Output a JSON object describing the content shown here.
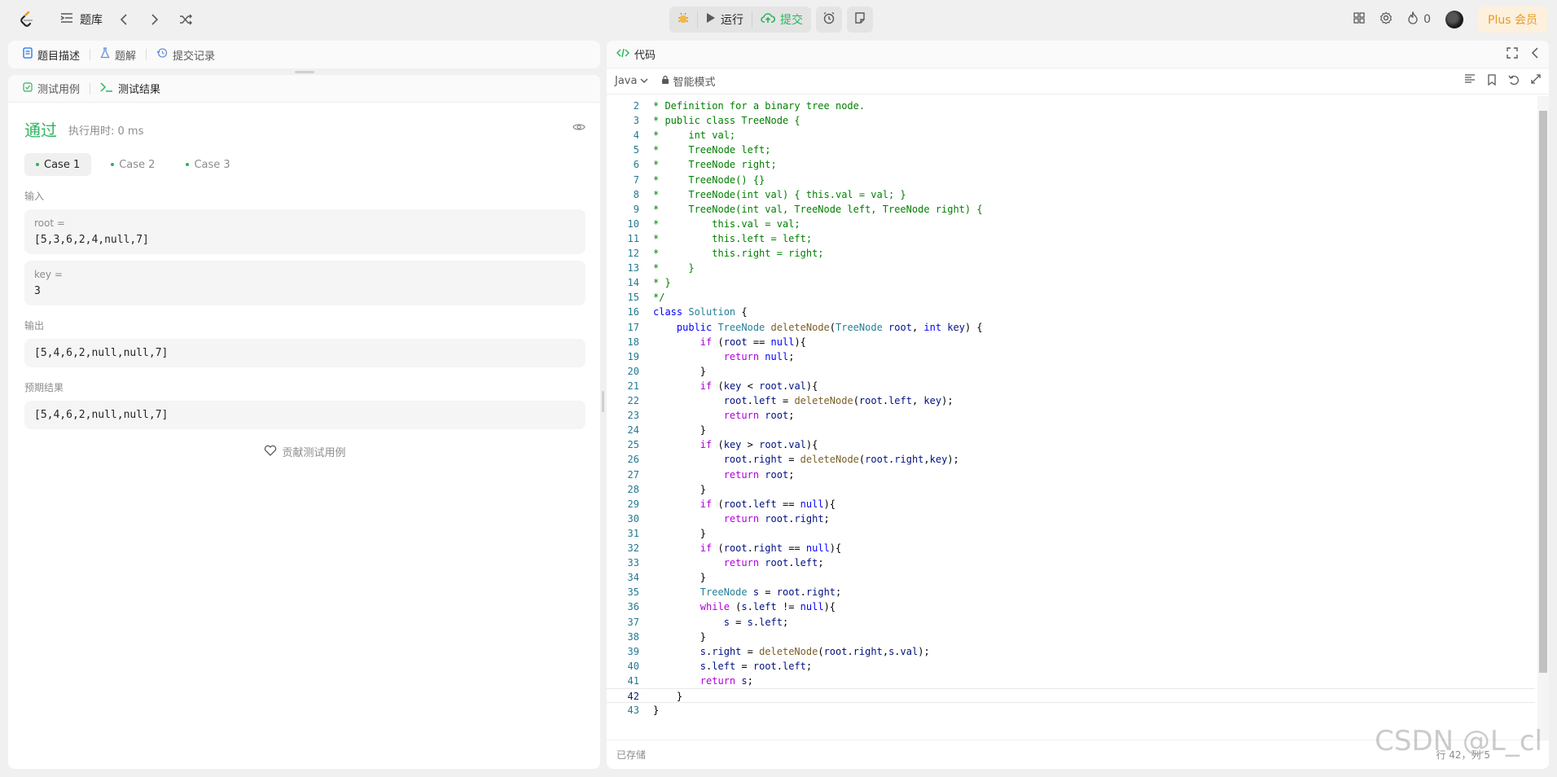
{
  "topnav": {
    "problem_list": "题库",
    "run": "运行",
    "submit": "提交",
    "fire_count": "0",
    "plus": "Plus 会员"
  },
  "desc_tabs": [
    {
      "label": "题目描述"
    },
    {
      "label": "题解"
    },
    {
      "label": "提交记录"
    }
  ],
  "result_tabs": [
    {
      "label": "测试用例"
    },
    {
      "label": "测试结果"
    }
  ],
  "result": {
    "status": "通过",
    "exec_time": "执行用时: 0 ms",
    "cases": [
      "Case 1",
      "Case 2",
      "Case 3"
    ],
    "input_label": "输入",
    "inputs": [
      {
        "name": "root =",
        "value": "[5,3,6,2,4,null,7]"
      },
      {
        "name": "key =",
        "value": "3"
      }
    ],
    "output_label": "输出",
    "output": "[5,4,6,2,null,null,7]",
    "expected_label": "预期结果",
    "expected": "[5,4,6,2,null,null,7]",
    "contribute": "贡献测试用例"
  },
  "code": {
    "title": "代码",
    "language": "Java",
    "mode": "智能模式",
    "saved": "已存储",
    "cursor": "行 42，列 5",
    "watermark": "CSDN @L_cl",
    "lines": [
      {
        "n": "2",
        "tokens": [
          [
            "c",
            "* Definition for a binary tree node."
          ]
        ]
      },
      {
        "n": "3",
        "tokens": [
          [
            "c",
            "* public class TreeNode {"
          ]
        ]
      },
      {
        "n": "4",
        "tokens": [
          [
            "c",
            "*     int val;"
          ]
        ]
      },
      {
        "n": "5",
        "tokens": [
          [
            "c",
            "*     TreeNode left;"
          ]
        ]
      },
      {
        "n": "6",
        "tokens": [
          [
            "c",
            "*     TreeNode right;"
          ]
        ]
      },
      {
        "n": "7",
        "tokens": [
          [
            "c",
            "*     TreeNode() {}"
          ]
        ]
      },
      {
        "n": "8",
        "tokens": [
          [
            "c",
            "*     TreeNode(int val) { this.val = val; }"
          ]
        ]
      },
      {
        "n": "9",
        "tokens": [
          [
            "c",
            "*     TreeNode(int val, TreeNode left, TreeNode right) {"
          ]
        ]
      },
      {
        "n": "10",
        "tokens": [
          [
            "c",
            "*         this.val = val;"
          ]
        ]
      },
      {
        "n": "11",
        "tokens": [
          [
            "c",
            "*         this.left = left;"
          ]
        ]
      },
      {
        "n": "12",
        "tokens": [
          [
            "c",
            "*         this.right = right;"
          ]
        ]
      },
      {
        "n": "13",
        "tokens": [
          [
            "c",
            "*     }"
          ]
        ]
      },
      {
        "n": "14",
        "tokens": [
          [
            "c",
            "* }"
          ]
        ]
      },
      {
        "n": "15",
        "tokens": [
          [
            "c",
            "*/"
          ]
        ]
      },
      {
        "n": "16",
        "tokens": [
          [
            "k",
            "class "
          ],
          [
            "t",
            "Solution"
          ],
          [
            "p",
            " {"
          ]
        ]
      },
      {
        "n": "17",
        "tokens": [
          [
            "p",
            "    "
          ],
          [
            "k",
            "public "
          ],
          [
            "t",
            "TreeNode "
          ],
          [
            "f",
            "deleteNode"
          ],
          [
            "p",
            "("
          ],
          [
            "t",
            "TreeNode "
          ],
          [
            "v",
            "root"
          ],
          [
            "p",
            ", "
          ],
          [
            "k",
            "int "
          ],
          [
            "v",
            "key"
          ],
          [
            "p",
            ") {"
          ]
        ]
      },
      {
        "n": "18",
        "tokens": [
          [
            "p",
            "        "
          ],
          [
            "kc",
            "if "
          ],
          [
            "p",
            "("
          ],
          [
            "v",
            "root"
          ],
          [
            "p",
            " == "
          ],
          [
            "k",
            "null"
          ],
          [
            "p",
            "){"
          ]
        ]
      },
      {
        "n": "19",
        "tokens": [
          [
            "p",
            "            "
          ],
          [
            "kc",
            "return "
          ],
          [
            "k",
            "null"
          ],
          [
            "p",
            ";"
          ]
        ]
      },
      {
        "n": "20",
        "tokens": [
          [
            "p",
            "        }"
          ]
        ]
      },
      {
        "n": "21",
        "tokens": [
          [
            "p",
            "        "
          ],
          [
            "kc",
            "if "
          ],
          [
            "p",
            "("
          ],
          [
            "v",
            "key"
          ],
          [
            "p",
            " < "
          ],
          [
            "v",
            "root"
          ],
          [
            "p",
            "."
          ],
          [
            "v",
            "val"
          ],
          [
            "p",
            "){"
          ]
        ]
      },
      {
        "n": "22",
        "tokens": [
          [
            "p",
            "            "
          ],
          [
            "v",
            "root"
          ],
          [
            "p",
            "."
          ],
          [
            "v",
            "left"
          ],
          [
            "p",
            " = "
          ],
          [
            "f",
            "deleteNode"
          ],
          [
            "p",
            "("
          ],
          [
            "v",
            "root"
          ],
          [
            "p",
            "."
          ],
          [
            "v",
            "left"
          ],
          [
            "p",
            ", "
          ],
          [
            "v",
            "key"
          ],
          [
            "p",
            ");"
          ]
        ]
      },
      {
        "n": "23",
        "tokens": [
          [
            "p",
            "            "
          ],
          [
            "kc",
            "return "
          ],
          [
            "v",
            "root"
          ],
          [
            "p",
            ";"
          ]
        ]
      },
      {
        "n": "24",
        "tokens": [
          [
            "p",
            "        }"
          ]
        ]
      },
      {
        "n": "25",
        "tokens": [
          [
            "p",
            "        "
          ],
          [
            "kc",
            "if "
          ],
          [
            "p",
            "("
          ],
          [
            "v",
            "key"
          ],
          [
            "p",
            " > "
          ],
          [
            "v",
            "root"
          ],
          [
            "p",
            "."
          ],
          [
            "v",
            "val"
          ],
          [
            "p",
            "){"
          ]
        ]
      },
      {
        "n": "26",
        "tokens": [
          [
            "p",
            "            "
          ],
          [
            "v",
            "root"
          ],
          [
            "p",
            "."
          ],
          [
            "v",
            "right"
          ],
          [
            "p",
            " = "
          ],
          [
            "f",
            "deleteNode"
          ],
          [
            "p",
            "("
          ],
          [
            "v",
            "root"
          ],
          [
            "p",
            "."
          ],
          [
            "v",
            "right"
          ],
          [
            "p",
            ","
          ],
          [
            "v",
            "key"
          ],
          [
            "p",
            ");"
          ]
        ]
      },
      {
        "n": "27",
        "tokens": [
          [
            "p",
            "            "
          ],
          [
            "kc",
            "return "
          ],
          [
            "v",
            "root"
          ],
          [
            "p",
            ";"
          ]
        ]
      },
      {
        "n": "28",
        "tokens": [
          [
            "p",
            "        }"
          ]
        ]
      },
      {
        "n": "29",
        "tokens": [
          [
            "p",
            "        "
          ],
          [
            "kc",
            "if "
          ],
          [
            "p",
            "("
          ],
          [
            "v",
            "root"
          ],
          [
            "p",
            "."
          ],
          [
            "v",
            "left"
          ],
          [
            "p",
            " == "
          ],
          [
            "k",
            "null"
          ],
          [
            "p",
            "){"
          ]
        ]
      },
      {
        "n": "30",
        "tokens": [
          [
            "p",
            "            "
          ],
          [
            "kc",
            "return "
          ],
          [
            "v",
            "root"
          ],
          [
            "p",
            "."
          ],
          [
            "v",
            "right"
          ],
          [
            "p",
            ";"
          ]
        ]
      },
      {
        "n": "31",
        "tokens": [
          [
            "p",
            "        }"
          ]
        ]
      },
      {
        "n": "32",
        "tokens": [
          [
            "p",
            "        "
          ],
          [
            "kc",
            "if "
          ],
          [
            "p",
            "("
          ],
          [
            "v",
            "root"
          ],
          [
            "p",
            "."
          ],
          [
            "v",
            "right"
          ],
          [
            "p",
            " == "
          ],
          [
            "k",
            "null"
          ],
          [
            "p",
            "){"
          ]
        ]
      },
      {
        "n": "33",
        "tokens": [
          [
            "p",
            "            "
          ],
          [
            "kc",
            "return "
          ],
          [
            "v",
            "root"
          ],
          [
            "p",
            "."
          ],
          [
            "v",
            "left"
          ],
          [
            "p",
            ";"
          ]
        ]
      },
      {
        "n": "34",
        "tokens": [
          [
            "p",
            "        }"
          ]
        ]
      },
      {
        "n": "35",
        "tokens": [
          [
            "p",
            "        "
          ],
          [
            "t",
            "TreeNode "
          ],
          [
            "v",
            "s"
          ],
          [
            "p",
            " = "
          ],
          [
            "v",
            "root"
          ],
          [
            "p",
            "."
          ],
          [
            "v",
            "right"
          ],
          [
            "p",
            ";"
          ]
        ]
      },
      {
        "n": "36",
        "tokens": [
          [
            "p",
            "        "
          ],
          [
            "kc",
            "while "
          ],
          [
            "p",
            "("
          ],
          [
            "v",
            "s"
          ],
          [
            "p",
            "."
          ],
          [
            "v",
            "left"
          ],
          [
            "p",
            " != "
          ],
          [
            "k",
            "null"
          ],
          [
            "p",
            "){"
          ]
        ]
      },
      {
        "n": "37",
        "tokens": [
          [
            "p",
            "            "
          ],
          [
            "v",
            "s"
          ],
          [
            "p",
            " = "
          ],
          [
            "v",
            "s"
          ],
          [
            "p",
            "."
          ],
          [
            "v",
            "left"
          ],
          [
            "p",
            ";"
          ]
        ]
      },
      {
        "n": "38",
        "tokens": [
          [
            "p",
            "        }"
          ]
        ]
      },
      {
        "n": "39",
        "tokens": [
          [
            "p",
            "        "
          ],
          [
            "v",
            "s"
          ],
          [
            "p",
            "."
          ],
          [
            "v",
            "right"
          ],
          [
            "p",
            " = "
          ],
          [
            "f",
            "deleteNode"
          ],
          [
            "p",
            "("
          ],
          [
            "v",
            "root"
          ],
          [
            "p",
            "."
          ],
          [
            "v",
            "right"
          ],
          [
            "p",
            ","
          ],
          [
            "v",
            "s"
          ],
          [
            "p",
            "."
          ],
          [
            "v",
            "val"
          ],
          [
            "p",
            ");"
          ]
        ]
      },
      {
        "n": "40",
        "tokens": [
          [
            "p",
            "        "
          ],
          [
            "v",
            "s"
          ],
          [
            "p",
            "."
          ],
          [
            "v",
            "left"
          ],
          [
            "p",
            " = "
          ],
          [
            "v",
            "root"
          ],
          [
            "p",
            "."
          ],
          [
            "v",
            "left"
          ],
          [
            "p",
            ";"
          ]
        ]
      },
      {
        "n": "41",
        "tokens": [
          [
            "p",
            "        "
          ],
          [
            "kc",
            "return "
          ],
          [
            "v",
            "s"
          ],
          [
            "p",
            ";"
          ]
        ]
      },
      {
        "n": "42",
        "tokens": [
          [
            "p",
            "    }"
          ]
        ],
        "current": true
      },
      {
        "n": "43",
        "tokens": [
          [
            "p",
            "}"
          ]
        ]
      }
    ]
  }
}
